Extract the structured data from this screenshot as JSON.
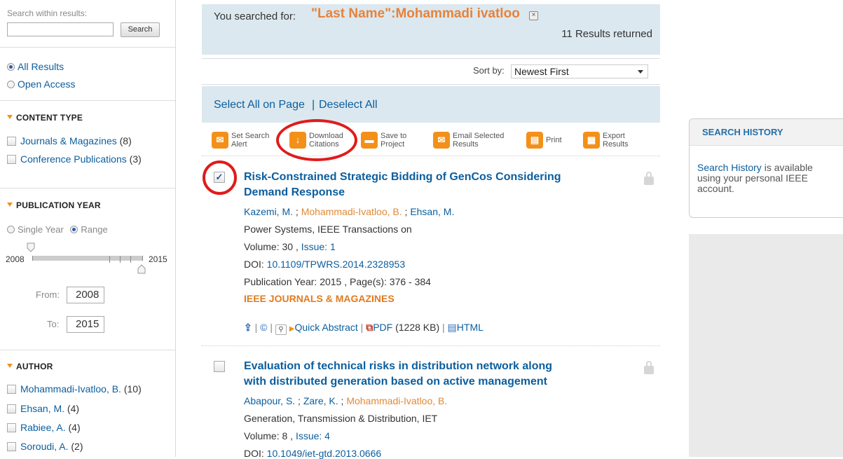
{
  "sidebar": {
    "search_label": "Search within results:",
    "search_value": "",
    "search_button": "Search",
    "access": {
      "all": "All Results",
      "open": "Open Access",
      "selected": "All Results"
    },
    "content_type": {
      "heading": "CONTENT TYPE",
      "items": [
        {
          "label": "Journals & Magazines",
          "count": "(8)"
        },
        {
          "label": "Conference Publications",
          "count": "(3)"
        }
      ]
    },
    "publication_year": {
      "heading": "PUBLICATION YEAR",
      "single_year": "Single Year",
      "range": "Range",
      "mode": "Range",
      "min": "2008",
      "max": "2015",
      "from_label": "From:",
      "from_value": "2008",
      "to_label": "To:",
      "to_value": "2015"
    },
    "author": {
      "heading": "AUTHOR",
      "items": [
        {
          "label": "Mohammadi-Ivatloo, B.",
          "count": "(10)"
        },
        {
          "label": "Ehsan, M.",
          "count": "(4)"
        },
        {
          "label": "Rabiee, A.",
          "count": "(4)"
        },
        {
          "label": "Soroudi, A.",
          "count": "(2)"
        }
      ]
    }
  },
  "search": {
    "you_searched_for": "You searched for:",
    "query": "\"Last Name\":Mohammadi ivatloo",
    "results_returned": "11 Results returned",
    "sort_label": "Sort by:",
    "sort_value": "Newest First"
  },
  "selection": {
    "select_all": "Select All on Page",
    "separator": "|",
    "deselect_all": "Deselect All"
  },
  "toolbar": {
    "set_search_alert": [
      "Set Search",
      "Alert"
    ],
    "download_citations": [
      "Download",
      "Citations"
    ],
    "save_to_project": [
      "Save to",
      "Project"
    ],
    "email_selected": [
      "Email Selected",
      "Results"
    ],
    "print": "Print",
    "export_results": [
      "Export",
      "Results"
    ]
  },
  "results": [
    {
      "checked": true,
      "title_line1": "Risk-Constrained Strategic Bidding of GenCos Considering",
      "title_line2": "Demand Response",
      "authors": [
        "Kazemi, M.",
        "Mohammadi-Ivatloo, B.",
        "Ehsan, M."
      ],
      "author_sep": " ; ",
      "journal": "Power Systems, IEEE Transactions on",
      "volume_label": "Volume: 30 ,",
      "issue": "Issue: 1",
      "doi_label": "DOI:",
      "doi": "10.1109/TPWRS.2014.2328953",
      "pub_info": "Publication Year: 2015 , Page(s): 376 - 384",
      "pub_type": "IEEE JOURNALS & MAGAZINES",
      "quick_abstract": "Quick Abstract",
      "pdf": "PDF",
      "pdf_size": "(1228 KB)",
      "html": "HTML"
    },
    {
      "checked": false,
      "title_line1": "Evaluation of technical risks in distribution network along",
      "title_line2": "with distributed generation based on active management",
      "authors": [
        "Abapour, S.",
        "Zare, K.",
        "Mohammadi-Ivatloo, B."
      ],
      "author_sep": " ; ",
      "journal": "Generation, Transmission & Distribution, IET",
      "volume_label": "Volume: 8 ,",
      "issue": "Issue: 4",
      "doi_label": "DOI:",
      "doi": "10.1049/iet-gtd.2013.0666"
    }
  ],
  "history": {
    "heading": "SEARCH HISTORY",
    "link": "Search History",
    "text1": " is available",
    "text2": "using your personal IEEE",
    "text3": "account."
  },
  "colors": {
    "accent_orange": "#f39019",
    "link_blue": "#0b5e9e",
    "banner_bg": "#dce8ef",
    "highlight_red": "#e01b1b"
  }
}
